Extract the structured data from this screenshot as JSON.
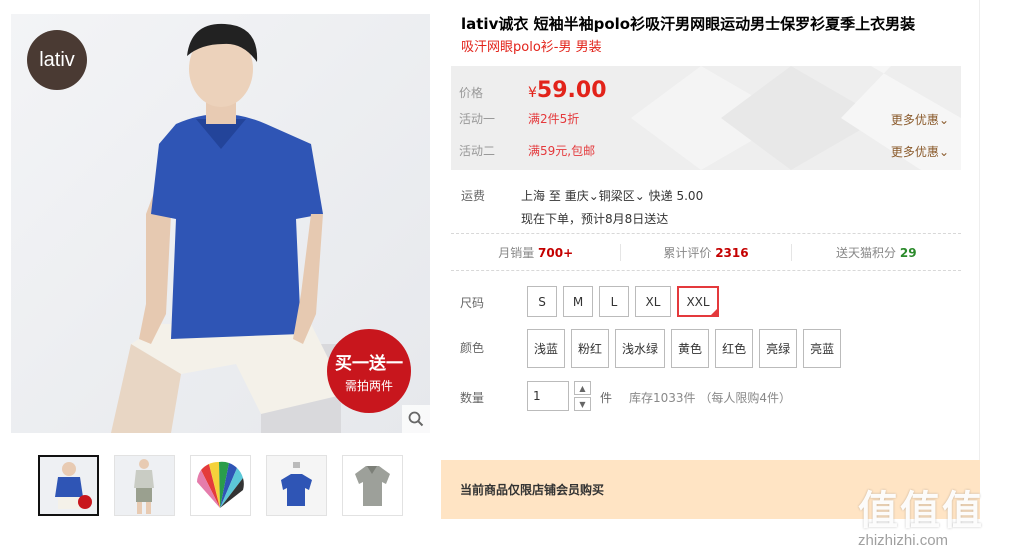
{
  "gallery": {
    "brand_logo": "lativ",
    "promo_main": "买一送一",
    "promo_sub": "需拍两件",
    "zoom_icon": "magnifier-icon",
    "thumbnails": [
      "model-front",
      "model-full-body",
      "color-fan",
      "folded-polo",
      "gray-polo"
    ]
  },
  "product": {
    "title": "lativ诚衣 短袖半袖polo衫吸汗男网眼运动男士保罗衫夏季上衣男装",
    "subtitle": "吸汗网眼polo衫-男 男装"
  },
  "price_panel": {
    "price_label": "价格",
    "currency": "¥",
    "price": "59.00",
    "promo1_label": "活动一",
    "promo1_value": "满2件5折",
    "promo2_label": "活动二",
    "promo2_value": "满59元,包邮",
    "more_label": "更多优惠"
  },
  "shipping": {
    "label": "运费",
    "from": "上海",
    "to_word": "至",
    "city": "重庆",
    "district": "铜梁区",
    "method": "快递 5.00",
    "eta": "现在下单，预计8月8日送达"
  },
  "stats": {
    "monthly_label": "月销量",
    "monthly_value": "700+",
    "reviews_label": "累计评价",
    "reviews_value": "2316",
    "points_label": "送天猫积分",
    "points_value": "29"
  },
  "options": {
    "size_label": "尺码",
    "sizes": [
      "S",
      "M",
      "L",
      "XL",
      "XXL"
    ],
    "selected_size": "XXL",
    "color_label": "颜色",
    "colors": [
      "浅蓝",
      "粉红",
      "浅水绿",
      "黄色",
      "红色",
      "亮绿",
      "亮蓝"
    ],
    "qty_label": "数量",
    "qty_value": "1",
    "qty_unit": "件",
    "stock_text": "库存1033件",
    "limit_text": "（每人限购4件）"
  },
  "member_notice": "当前商品仅限店铺会员购买",
  "watermark": {
    "glyphs": "值值值",
    "url": "zhizhizhi.com"
  },
  "colors_theme": {
    "accent_red": "#e2231a",
    "promo_bg": "#ffe4c4",
    "panel_bg": "#eeeeee"
  }
}
